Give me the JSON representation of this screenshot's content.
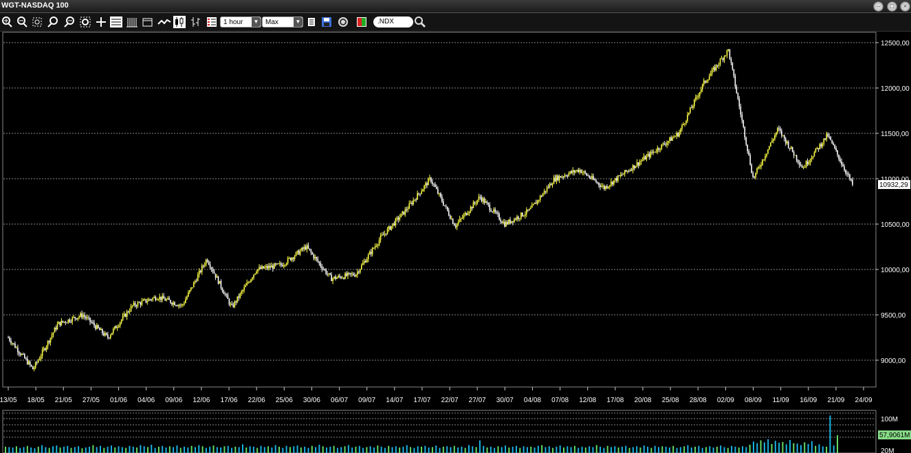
{
  "window": {
    "title": "WGT-NASDAQ 100"
  },
  "toolbar": {
    "interval_value": "1 hour",
    "range_value": "Max",
    "symbol_value": ".NDX",
    "buttons": [
      "zoom-in-icon",
      "zoom-out-icon",
      "zoom-fit-icon",
      "zoom-x-icon",
      "zoom-y-icon",
      "zoom-reset-icon",
      "crosshair-icon",
      "grid-icon",
      "bars-icon",
      "window-icon",
      "line-chart-icon",
      "candlestick-icon",
      "ohlc-icon",
      "list-icon",
      "table-icon",
      "save-icon",
      "refresh-icon",
      "color-icon",
      "search-icon"
    ]
  },
  "colors": {
    "up": "#ffff44",
    "down": "#ffffff",
    "grid": "#bbbbbb",
    "volume": "#1ab3e6",
    "volume_alt": "#66dd66",
    "last_price_box": "#ffffff",
    "volume_box": "#88dd88"
  },
  "chart_data": [
    {
      "type": "candlestick",
      "title": "",
      "ylabel": "",
      "ylim": [
        8750,
        12600
      ],
      "yticks": [
        "9000,00",
        "9500,00",
        "10000,00",
        "10500,00",
        "11000,00",
        "11500,00",
        "12000,00",
        "12500,00"
      ],
      "ytick_values": [
        9000,
        9500,
        10000,
        10500,
        11000,
        11500,
        12000,
        12500
      ],
      "xticks": [
        "13/05",
        "18/05",
        "21/05",
        "27/05",
        "01/06",
        "04/06",
        "09/06",
        "12/06",
        "17/06",
        "22/06",
        "25/06",
        "30/06",
        "06/07",
        "09/07",
        "14/07",
        "17/07",
        "22/07",
        "27/07",
        "30/07",
        "04/08",
        "07/08",
        "12/08",
        "17/08",
        "20/08",
        "25/08",
        "28/08",
        "02/09",
        "08/09",
        "11/09",
        "16/09",
        "21/09",
        "24/09"
      ],
      "last_price": "10932,29",
      "last_value": 10932.29,
      "series": [
        {
          "x": [
            0,
            1.4,
            2.5,
            3.5,
            4.5,
            5.5,
            6.5,
            7.5,
            8.5,
            9.5,
            10.5,
            11.5,
            12.5,
            13.5,
            14.5,
            15.5,
            16.5,
            17.5,
            18.5,
            19.5,
            20.5,
            21.5,
            22.5,
            23.5,
            24.5,
            25.5,
            26.5,
            27.5,
            28.5,
            29.5,
            30.5
          ],
          "close": [
            9250,
            8900,
            9400,
            9500,
            9250,
            9600,
            9700,
            9600,
            10120,
            9580,
            10000,
            10050,
            10250,
            9900,
            9950,
            10350,
            10650,
            11000,
            10480,
            10800,
            10500,
            10650,
            11000,
            11100,
            10900,
            11100,
            11300,
            11500,
            12050,
            12420,
            11000,
            11550,
            11120,
            11480,
            10932
          ]
        }
      ]
    },
    {
      "type": "bar",
      "title": "",
      "yticks": [
        "100M",
        "20M"
      ],
      "ytick_values": [
        100,
        20
      ],
      "ylim": [
        20,
        115
      ],
      "last_volume": "57,9061M",
      "last_volume_value": 57.9061,
      "values": [
        29,
        28,
        27,
        30,
        26,
        28,
        31,
        27,
        25,
        29,
        33,
        28,
        26,
        30,
        32,
        27,
        29,
        31,
        26,
        28,
        30,
        25,
        27,
        29,
        33,
        28,
        31,
        26,
        29,
        32,
        27,
        30,
        28,
        26,
        31,
        29,
        27,
        33,
        30,
        28,
        34,
        26,
        29,
        31,
        27,
        30,
        28,
        32,
        26,
        29,
        27,
        31,
        28,
        33,
        30,
        26,
        29,
        32,
        28,
        27,
        30,
        31,
        26,
        29,
        28,
        35,
        27,
        30,
        29,
        26,
        31,
        28,
        30,
        27,
        33,
        29,
        26,
        31,
        28,
        30,
        32,
        27,
        29,
        26,
        31,
        28,
        34,
        30,
        27,
        29,
        31,
        26,
        28,
        30,
        33,
        27,
        29,
        31,
        26,
        28,
        30,
        27,
        32,
        29,
        26,
        31,
        28,
        30,
        27,
        29,
        33,
        28,
        26,
        30,
        29,
        31,
        27,
        28,
        32,
        26,
        29,
        30,
        28,
        31,
        27,
        29,
        26,
        33,
        30,
        28,
        45,
        31,
        27,
        29,
        26,
        30,
        28,
        32,
        27,
        29,
        31,
        26,
        30,
        28,
        29,
        27,
        31,
        33,
        28,
        30,
        26,
        29,
        32,
        27,
        30,
        28,
        31,
        26,
        29,
        27,
        30,
        28,
        33,
        29,
        26,
        31,
        28,
        30,
        27,
        29,
        31,
        26,
        28,
        30,
        27,
        32,
        29,
        26,
        31,
        28,
        30,
        29,
        27,
        31,
        26,
        28,
        30,
        33,
        27,
        29,
        31,
        26,
        28,
        30,
        27,
        29,
        32,
        28,
        26,
        31,
        29,
        27,
        30,
        28,
        34,
        42,
        38,
        45,
        40,
        48,
        36,
        44,
        39,
        41,
        35,
        46,
        38,
        37,
        33,
        40,
        36,
        43,
        31,
        35,
        30,
        29,
        108,
        32,
        57.9
      ]
    }
  ]
}
